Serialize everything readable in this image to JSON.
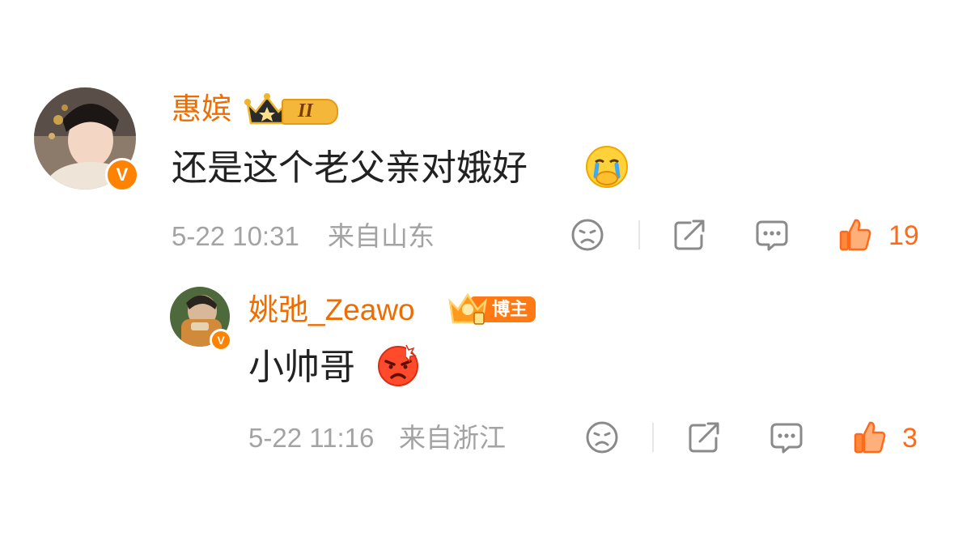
{
  "comment": {
    "author": "惠嫔",
    "level_badge": "II",
    "text": "还是这个老父亲对娥好",
    "date": "5-22 10:31",
    "location": "来自山东",
    "likes": "19"
  },
  "reply": {
    "author": "姚弛_Zeawo",
    "role_badge": "博主",
    "text": "小帅哥",
    "date": "5-22 11:16",
    "location": "来自浙江",
    "likes": "3"
  },
  "colors": {
    "accent": "#ff8200",
    "name": "#ef6c00",
    "like": "#ff6a1a",
    "meta": "#a3a3a3"
  },
  "icons": [
    "verified-v-icon",
    "crown-icon",
    "crying-emoji-icon",
    "angry-emoji-icon",
    "dislike-face-icon",
    "share-icon",
    "comment-icon",
    "thumbs-up-icon"
  ]
}
